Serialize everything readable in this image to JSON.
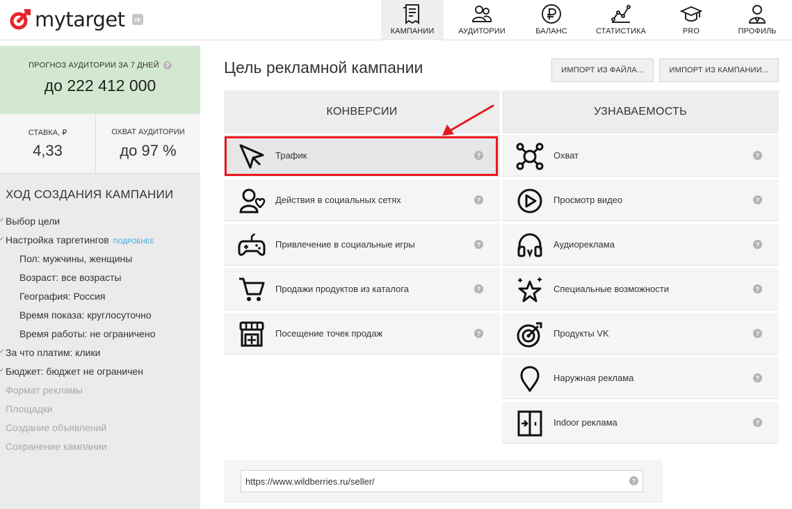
{
  "header": {
    "logo_text": "mytarget",
    "vk_badge": "vk",
    "nav": [
      {
        "label": "КАМПАНИИ",
        "icon": "campaigns-icon"
      },
      {
        "label": "АУДИТОРИИ",
        "icon": "audiences-icon"
      },
      {
        "label": "БАЛАНС",
        "icon": "ruble-icon"
      },
      {
        "label": "СТАТИСТИКА",
        "icon": "statistics-icon"
      },
      {
        "label": "PRO",
        "icon": "graduation-cap-icon"
      },
      {
        "label": "ПРОФИЛЬ",
        "icon": "profile-icon"
      }
    ]
  },
  "sidebar": {
    "forecast_label": "ПРОГНОЗ АУДИТОРИИ ЗА 7 ДНЕЙ",
    "forecast_value": "до 222 412 000",
    "rate_label": "СТАВКА, ₽",
    "rate_value": "4,33",
    "reach_label": "ОХВАТ АУДИТОРИИ",
    "reach_value": "до 97 %",
    "steps_title": "ХОД СОЗДАНИЯ КАМПАНИИ",
    "more_link": "ПОДРОБНЕЕ",
    "steps": [
      {
        "label": "Выбор цели"
      },
      {
        "label": "Настройка таргетингов"
      },
      {
        "label": "Пол: мужчины, женщины"
      },
      {
        "label": "Возраст: все возрасты"
      },
      {
        "label": "География: Россия"
      },
      {
        "label": "Время показа: круглосуточно"
      },
      {
        "label": "Время работы: не ограничено"
      },
      {
        "label": "За что платим: клики"
      },
      {
        "label": "Бюджет: бюджет не ограничен"
      },
      {
        "label": "Формат рекламы"
      },
      {
        "label": "Площадки"
      },
      {
        "label": "Создание объявлений"
      },
      {
        "label": "Сохранение кампании"
      }
    ]
  },
  "main": {
    "title": "Цель рекламной кампании",
    "import_file_button": "ИМПОРТ ИЗ ФАЙЛА...",
    "import_campaign_button": "ИМПОРТ ИЗ КАМПАНИИ...",
    "help_glyph": "?",
    "conversions": {
      "title": "КОНВЕРСИИ",
      "goals": [
        {
          "label": "Трафик",
          "icon": "cursor-icon"
        },
        {
          "label": "Действия в социальных сетях",
          "icon": "social-actions-icon"
        },
        {
          "label": "Привлечение в социальные игры",
          "icon": "gamepad-icon"
        },
        {
          "label": "Продажи продуктов из каталога",
          "icon": "cart-icon"
        },
        {
          "label": "Посещение точек продаж",
          "icon": "storefront-icon"
        }
      ]
    },
    "awareness": {
      "title": "УЗНАВАЕМОСТЬ",
      "goals": [
        {
          "label": "Охват",
          "icon": "reach-network-icon"
        },
        {
          "label": "Просмотр видео",
          "icon": "play-icon"
        },
        {
          "label": "Аудиореклама",
          "icon": "headphones-icon"
        },
        {
          "label": "Специальные возможности",
          "icon": "star-sparkle-icon"
        },
        {
          "label": "Продукты VK",
          "icon": "target-icon"
        },
        {
          "label": "Наружная реклама",
          "icon": "map-pin-icon"
        },
        {
          "label": "Indoor реклама",
          "icon": "door-enter-icon"
        }
      ]
    },
    "url_value": "https://www.wildberries.ru/seller/"
  },
  "colors": {
    "forecast_bg": "#d3e8d0",
    "highlight": "#e8171d",
    "link": "#2a9fd6",
    "logo_red": "#e8242b"
  }
}
